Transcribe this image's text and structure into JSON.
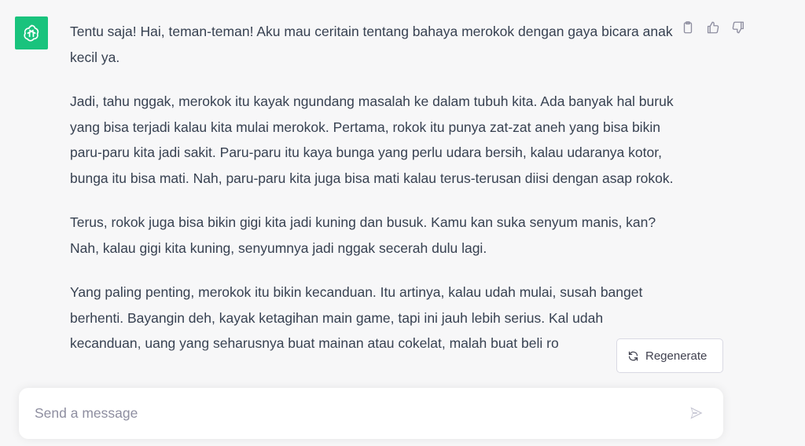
{
  "colors": {
    "background": "#f7f7f8",
    "avatar": "#19c37d",
    "text": "#374151",
    "icon": "#8e8ea0",
    "send_icon": "#c5c5d2"
  },
  "assistant": {
    "avatar_icon": "openai-logo-icon"
  },
  "message": {
    "paragraphs": [
      "Tentu saja! Hai, teman-teman! Aku mau ceritain tentang bahaya merokok dengan gaya bicara anak kecil ya.",
      "Jadi, tahu nggak, merokok itu kayak ngundang masalah ke dalam tubuh kita. Ada banyak hal buruk yang bisa terjadi kalau kita mulai merokok. Pertama, rokok itu punya zat-zat aneh yang bisa bikin paru-paru kita jadi sakit. Paru-paru itu kaya bunga yang perlu udara bersih, kalau udaranya kotor, bunga itu bisa mati. Nah, paru-paru kita juga bisa mati kalau terus-terusan diisi dengan asap rokok.",
      "Terus, rokok juga bisa bikin gigi kita jadi kuning dan busuk. Kamu kan suka senyum manis, kan? Nah, kalau gigi kita kuning, senyumnya jadi nggak secerah dulu lagi.",
      "Yang paling penting, merokok itu bikin kecanduan. Itu artinya, kalau udah mulai, susah banget berhenti. Bayangin deh, kayak ketagihan main game, tapi ini jauh lebih serius. Kal udah kecanduan, uang yang seharusnya buat mainan atau cokelat, malah buat beli ro"
    ]
  },
  "actions": {
    "copy_icon": "clipboard-icon",
    "like_icon": "thumbs-up-icon",
    "dislike_icon": "thumbs-down-icon"
  },
  "regenerate": {
    "label": "Regenerate",
    "icon": "refresh-icon"
  },
  "composer": {
    "placeholder": "Send a message",
    "value": "",
    "send_icon": "send-icon"
  }
}
